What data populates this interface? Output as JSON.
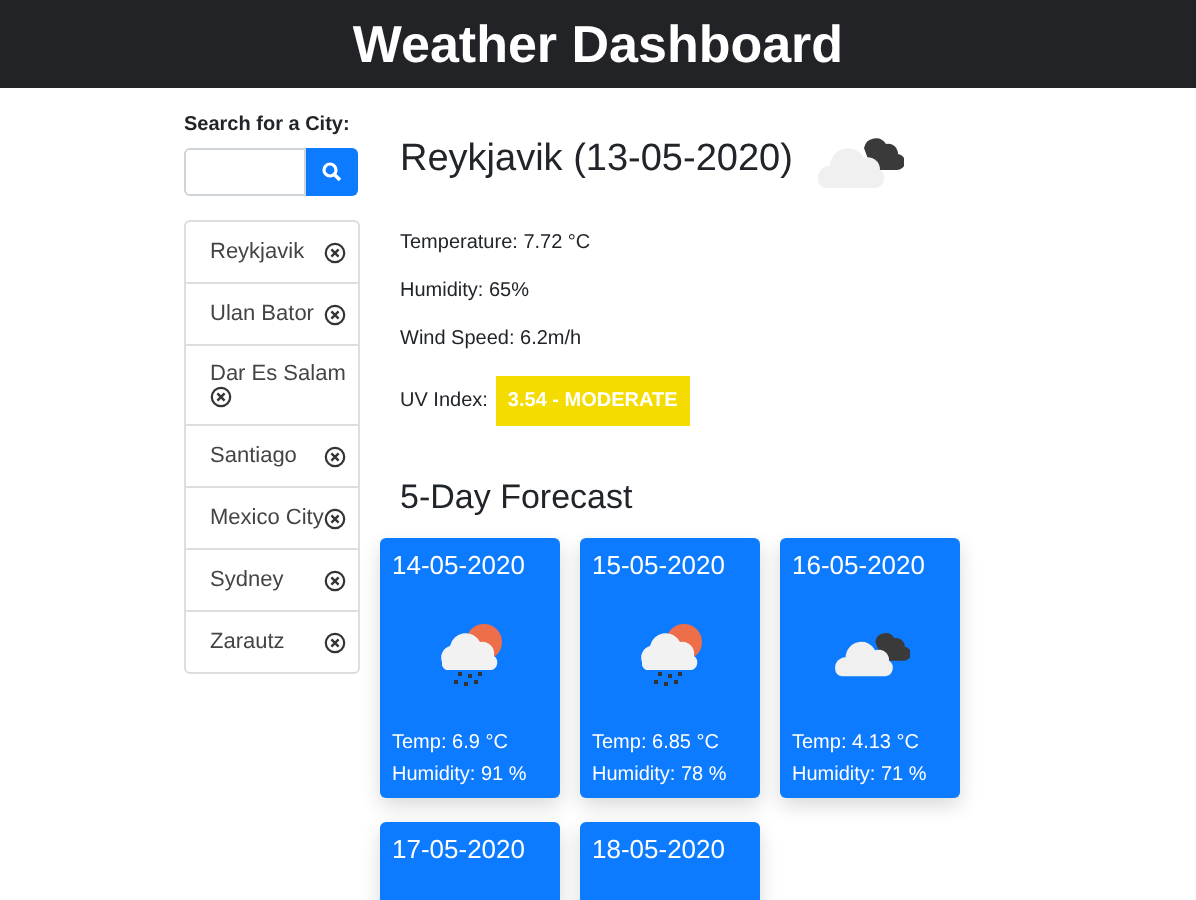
{
  "header": {
    "title": "Weather Dashboard"
  },
  "search": {
    "label": "Search for a City:"
  },
  "history": [
    {
      "city": "Reykjavik"
    },
    {
      "city": "Ulan Bator"
    },
    {
      "city": "Dar Es Salam"
    },
    {
      "city": "Santiago"
    },
    {
      "city": "Mexico City"
    },
    {
      "city": "Sydney"
    },
    {
      "city": "Zarautz"
    }
  ],
  "current": {
    "title": "Reykjavik (13-05-2020)",
    "kind": "cloudy",
    "temperature": "Temperature: 7.72 °C",
    "humidity": "Humidity: 65%",
    "wind": "Wind Speed: 6.2m/h",
    "uv_label": "UV Index:",
    "uv_value": "3.54 - MODERATE"
  },
  "forecast": {
    "title": "5-Day Forecast",
    "days": [
      {
        "date": "14-05-2020",
        "kind": "showers",
        "temp": "Temp: 6.9 °C",
        "humidity": "Humidity: 91 %"
      },
      {
        "date": "15-05-2020",
        "kind": "showers",
        "temp": "Temp: 6.85 °C",
        "humidity": "Humidity: 78 %"
      },
      {
        "date": "16-05-2020",
        "kind": "cloudy",
        "temp": "Temp: 4.13 °C",
        "humidity": "Humidity: 71 %"
      },
      {
        "date": "17-05-2020"
      },
      {
        "date": "18-05-2020"
      }
    ]
  }
}
